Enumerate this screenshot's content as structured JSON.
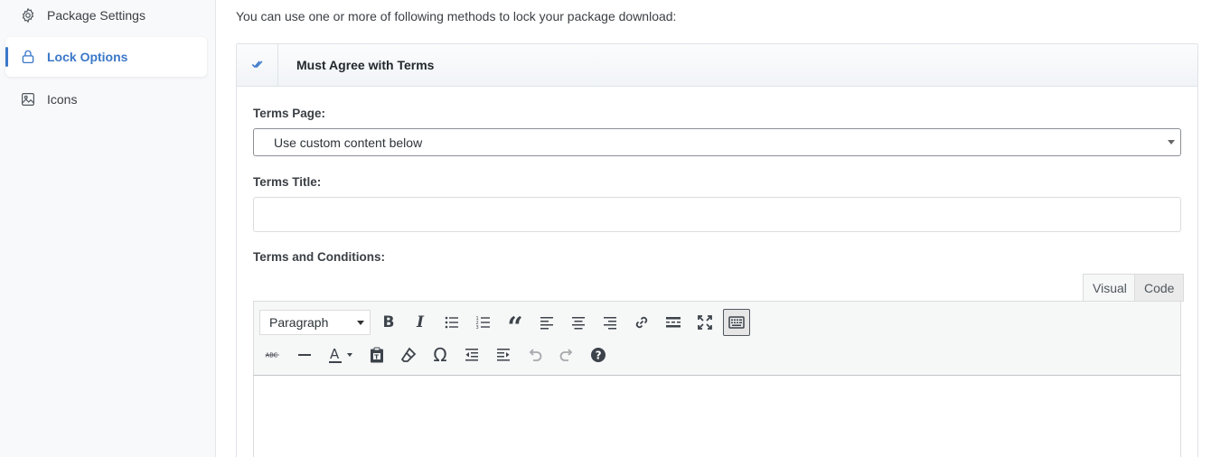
{
  "sidebar": {
    "items": [
      {
        "label": "Package Settings",
        "icon": "gear-icon"
      },
      {
        "label": "Lock Options",
        "icon": "lock-icon",
        "active": true
      },
      {
        "label": "Icons",
        "icon": "image-icon"
      }
    ]
  },
  "intro": "You can use one or more of following methods to lock your package download:",
  "panel": {
    "title": "Must Agree with Terms",
    "terms_page_label": "Terms Page:",
    "terms_page_value": "Use custom content below",
    "terms_title_label": "Terms Title:",
    "terms_title_value": "",
    "terms_conditions_label": "Terms and Conditions:"
  },
  "editor": {
    "tabs": {
      "visual": "Visual",
      "code": "Code"
    },
    "format_value": "Paragraph"
  },
  "colors": {
    "accent": "#3b78c8",
    "border": "#dcdcde"
  }
}
